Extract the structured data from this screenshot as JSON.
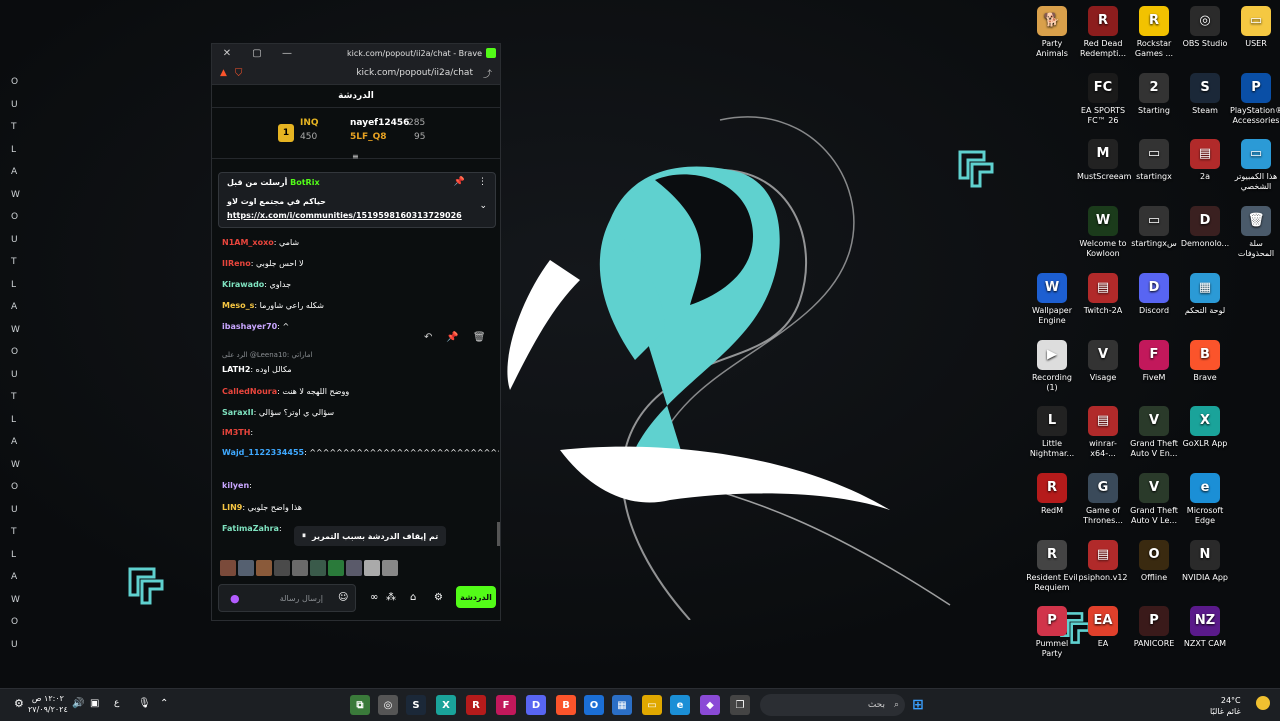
{
  "browser": {
    "title": "kick.com/popout/ii2a/chat - Brave",
    "url": "kick.com/popout/ii2a/chat"
  },
  "chat": {
    "header": "الدردشة",
    "leaderboard": [
      {
        "rank": "1",
        "name": "INQ",
        "value": "450"
      },
      {
        "name": "nayef12456",
        "value": "285"
      },
      {
        "name": "5LF_Q8",
        "value": "95"
      }
    ],
    "pinned": {
      "by": "أرسلت من قبل",
      "user": "BotRix",
      "text": "حياكم في مجتمع اوت لاو",
      "link": "https://x.com/i/communities/1519598160313729026"
    },
    "messages": [
      {
        "user": "N1AM_xoxo",
        "text": "شامي",
        "color": "#e8453c"
      },
      {
        "user": "IIReno",
        "text": "لا احس جلوبي",
        "color": "#e8453c"
      },
      {
        "user": "Kirawado",
        "text": "جداوي",
        "color": "#7fe3c0"
      },
      {
        "user": "Meso_s",
        "text": "شكله راعي شاورما",
        "color": "#f5c542"
      },
      {
        "user": "ibashayer70",
        "text": "^​​​​​​​​​​​​​​​​​​​​​​​​​​​​​​​​​​​​​​​​​​​​​​​​​​​​​​​​​​​​​​​​​​​​​​​​​​​​​​​​​​​​​​​​​​​​​​​​​​​​​​​​​​​​​​​​​​​​​​​​​​​​​​​​​​​​​​​​​​​​​​​​​​​​​​​​​​​​​​​​​​​​​​​​​​​​​​​​​​​​​​​​​​​​​​​​​​​​​​​​​​​​​​​​​​​​​​​​​​​​​​​​​​​​​​​​",
        "color": "#c9a6ff"
      },
      {
        "reply": "الرد على @Leena10: اماراتي"
      },
      {
        "user": "LATH2",
        "text": "مكالل اوده",
        "color": "#ffffff"
      },
      {
        "user": "CalledNoura",
        "text": "ووضح اللهجه لا هنت",
        "color": "#e8453c"
      },
      {
        "user": "SaraxII",
        "text": "سؤالي ي اوتر؟ سؤالي",
        "color": "#7fe3c0"
      },
      {
        "user": "iM3TH",
        "text": "",
        "color": "#e8453c"
      },
      {
        "user": "Wajd_1122334455",
        "text": "^^^^^^^^^^^^^^^^^^^^^^^^^^^^^^^^^^^^^^^^^^^^^^^^^^^^^^^^^^^^",
        "color": "#3fa9ff"
      },
      {
        "user": "kilyen",
        "text": "",
        "color": "#c9a6ff"
      },
      {
        "user": "LIN9",
        "text": "هذا واضح جلوبي",
        "color": "#f5c542"
      },
      {
        "user": "FatimaZahra",
        "text": "",
        "color": "#7fe3c0"
      }
    ],
    "paused_label": "تم إيقاف الدردشة بسبب التمرير",
    "input_placeholder": "إرسال رسالة",
    "send_label": "الدردشة"
  },
  "desktop_icons": [
    {
      "label": "Party Animals",
      "col": 0,
      "row": 0,
      "color": "#d9a04b",
      "glyph": "🐕"
    },
    {
      "label": "Red Dead Redempti...",
      "col": 1,
      "row": 0,
      "color": "#8c1d1d",
      "glyph": "R"
    },
    {
      "label": "Rockstar Games ...",
      "col": 2,
      "row": 0,
      "color": "#f2c200",
      "glyph": "R"
    },
    {
      "label": "OBS Studio",
      "col": 3,
      "row": 0,
      "color": "#2b2b2b",
      "glyph": "◎"
    },
    {
      "label": "USER",
      "col": 4,
      "row": 0,
      "color": "#f5c842",
      "glyph": "▭"
    },
    {
      "label": "EA SPORTS FC™ 26",
      "col": 1,
      "row": 1,
      "color": "#1a1a1a",
      "glyph": "FC"
    },
    {
      "label": "Starting",
      "col": 2,
      "row": 1,
      "color": "#333",
      "glyph": "2"
    },
    {
      "label": "Steam",
      "col": 3,
      "row": 1,
      "color": "#1b2838",
      "glyph": "S"
    },
    {
      "label": "PlayStation® Accessories",
      "col": 4,
      "row": 1,
      "color": "#0a4fa6",
      "glyph": "P"
    },
    {
      "label": "MustScreeam",
      "col": 1,
      "row": 2,
      "color": "#222",
      "glyph": "M"
    },
    {
      "label": "startingx",
      "col": 2,
      "row": 2,
      "color": "#333",
      "glyph": "▭"
    },
    {
      "label": "2a",
      "col": 3,
      "row": 2,
      "color": "#b12a2a",
      "glyph": "▤"
    },
    {
      "label": "هذا الكمبيوتر الشخصي",
      "col": 4,
      "row": 2,
      "color": "#2b9ad6",
      "glyph": "▭"
    },
    {
      "label": "Welcome to Kowloon",
      "col": 1,
      "row": 3,
      "color": "#1b3b1b",
      "glyph": "W"
    },
    {
      "label": "startingxس",
      "col": 2,
      "row": 3,
      "color": "#333",
      "glyph": "▭"
    },
    {
      "label": "Demonolo...",
      "col": 3,
      "row": 3,
      "color": "#3a2020",
      "glyph": "D"
    },
    {
      "label": "سلة المحذوفات",
      "col": 4,
      "row": 3,
      "color": "#4a5a6a",
      "glyph": "🗑"
    },
    {
      "label": "Wallpaper Engine",
      "col": 0,
      "row": 4,
      "color": "#1d5fd1",
      "glyph": "W"
    },
    {
      "label": "Twitch-2A",
      "col": 1,
      "row": 4,
      "color": "#b12a2a",
      "glyph": "▤"
    },
    {
      "label": "Discord",
      "col": 2,
      "row": 4,
      "color": "#5865f2",
      "glyph": "D"
    },
    {
      "label": "لوحة التحكم",
      "col": 3,
      "row": 4,
      "color": "#2b9ad6",
      "glyph": "▦"
    },
    {
      "label": "Recording (1)",
      "col": 0,
      "row": 5,
      "color": "#ddd",
      "glyph": "▶"
    },
    {
      "label": "Visage",
      "col": 1,
      "row": 5,
      "color": "#333",
      "glyph": "V"
    },
    {
      "label": "FiveM",
      "col": 2,
      "row": 5,
      "color": "#c2185b",
      "glyph": "F"
    },
    {
      "label": "Brave",
      "col": 3,
      "row": 5,
      "color": "#fb542b",
      "glyph": "B"
    },
    {
      "label": "Little Nightmar...",
      "col": 0,
      "row": 6,
      "color": "#222",
      "glyph": "L"
    },
    {
      "label": "winrar-x64-...",
      "col": 1,
      "row": 6,
      "color": "#b12a2a",
      "glyph": "▤"
    },
    {
      "label": "Grand Theft Auto V En...",
      "col": 2,
      "row": 6,
      "color": "#2a3a2a",
      "glyph": "V"
    },
    {
      "label": "GoXLR App",
      "col": 3,
      "row": 6,
      "color": "#1aa39a",
      "glyph": "X"
    },
    {
      "label": "RedM",
      "col": 0,
      "row": 7,
      "color": "#b51b1b",
      "glyph": "R"
    },
    {
      "label": "Game of Thrones...",
      "col": 1,
      "row": 7,
      "color": "#3a4a5a",
      "glyph": "G"
    },
    {
      "label": "Grand Theft Auto V Le...",
      "col": 2,
      "row": 7,
      "color": "#2a3a2a",
      "glyph": "V"
    },
    {
      "label": "Microsoft Edge",
      "col": 3,
      "row": 7,
      "color": "#1b8fd6",
      "glyph": "e"
    },
    {
      "label": "Resident Evil Requiem",
      "col": 0,
      "row": 8,
      "color": "#444",
      "glyph": "R"
    },
    {
      "label": "psiphon.v12",
      "col": 1,
      "row": 8,
      "color": "#b12a2a",
      "glyph": "▤"
    },
    {
      "label": "Offline",
      "col": 2,
      "row": 8,
      "color": "#3a2a10",
      "glyph": "O"
    },
    {
      "label": "NVIDIA App",
      "col": 3,
      "row": 8,
      "color": "#2a2a2a",
      "glyph": "N"
    },
    {
      "label": "Pummel Party",
      "col": 0,
      "row": 9,
      "color": "#d1344a",
      "glyph": "P"
    },
    {
      "label": "EA",
      "col": 1,
      "row": 9,
      "color": "#e0402b",
      "glyph": "EA"
    },
    {
      "label": "PANICORE",
      "col": 2,
      "row": 9,
      "color": "#3a1a1a",
      "glyph": "P"
    },
    {
      "label": "NZXT CAM",
      "col": 3,
      "row": 9,
      "color": "#5a1a8a",
      "glyph": "NZ"
    }
  ],
  "taskbar": {
    "time": "١٢:٠٢ ص",
    "date": "٢٧/٠٩/٢٠٢٤",
    "search_placeholder": "بحث",
    "weather_temp": "24°C",
    "weather_desc": "غائم غالبًا"
  },
  "side_letters": [
    "O",
    "U",
    "T",
    "L",
    "A",
    "W",
    "O",
    "U",
    "T",
    "L",
    "A",
    "W",
    "O",
    "U",
    "T",
    "L",
    "A",
    "W",
    "O",
    "U",
    "T",
    "L",
    "A",
    "W",
    "O",
    "U"
  ]
}
